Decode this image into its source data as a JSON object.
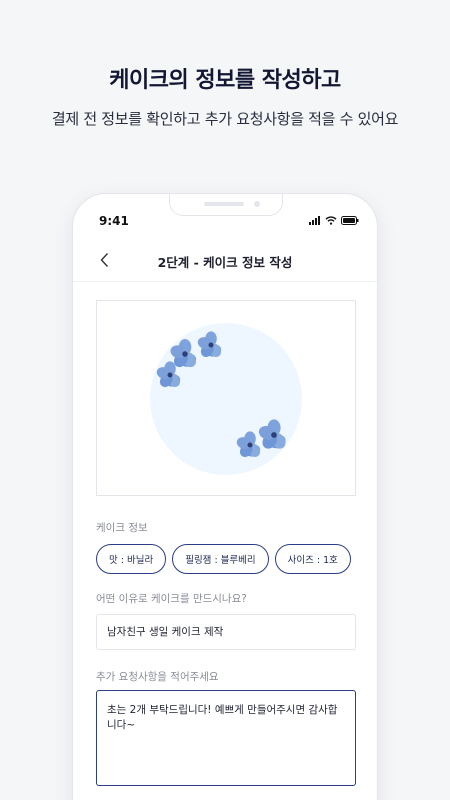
{
  "headline": "케이크의 정보를 작성하고",
  "subline": "결제 전 정보를 확인하고 추가 요청사항을 적을 수 있어요",
  "phone": {
    "status": {
      "time": "9:41"
    },
    "nav": {
      "back_icon": "chevron-left-icon",
      "title": "2단계 - 케이크 정보 작성"
    },
    "cake_preview": {
      "description_icon": "cake-top-view-with-blue-flowers"
    },
    "cake_info": {
      "label": "케이크 정보",
      "chips": [
        {
          "label": "맛 : 바닐라"
        },
        {
          "label": "필링잼 : 블루베리"
        },
        {
          "label": "사이즈 : 1호"
        }
      ]
    },
    "reason": {
      "label": "어떤 이유로 케이크를 만드시나요?",
      "value": "남자친구 생일 케이크 제작"
    },
    "request": {
      "label": "추가 요청사항을 적어주세요",
      "value": "초는 2개 부탁드립니다! 예쁘게 만들어주시면 감사합니다~"
    }
  },
  "colors": {
    "accent": "#2a3d86",
    "cake_fill": "#eef7ff",
    "flower": "#6f96d6"
  }
}
